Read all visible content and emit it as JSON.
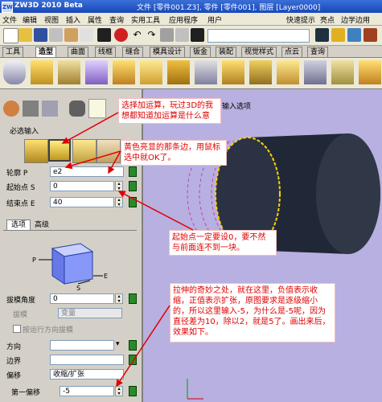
{
  "titlebar": {
    "app_title": "ZW3D 2010 Beta",
    "doc_info": "文件 [零件001.Z3], 零件 [零件001], 图层 [Layer0000]",
    "logo": "ZW"
  },
  "menubar": {
    "items": [
      "文件",
      "编辑",
      "视图",
      "插入",
      "属性",
      "查询",
      "实用工具",
      "应用程序",
      "用户"
    ],
    "right_items": [
      "快速提示",
      "亮点",
      "边学边用"
    ]
  },
  "tabs": [
    "工具",
    "造型",
    "曲面",
    "线框",
    "缝合",
    "模具设计",
    "钣金",
    "装配",
    "视觉样式",
    "点云",
    "查询"
  ],
  "active_tab": "造型",
  "panel": {
    "required_title": "必选输入",
    "profile_label": "轮廓 P",
    "profile_value": "e2",
    "start_label": "起始点 S",
    "start_value": "0",
    "end_label": "结束点 E",
    "end_value": "40",
    "subtabs": [
      "选项",
      "高级"
    ],
    "diagram_labels": {
      "p": "P",
      "s": "S",
      "e": "E"
    },
    "draft_angle_label": "拔模角度",
    "draft_angle_value": "0",
    "draft_type_label": "拔模",
    "draft_type_value": "变量",
    "draft_check_label": "按运行方向拔模",
    "direction_label": "方向",
    "boundary_label": "边界",
    "offset_label": "偏移",
    "offset_value": "收缩/扩张",
    "first_offset_label": "第一偏移",
    "first_offset_value": "-5"
  },
  "viewport": {
    "input_option": "输入选项"
  },
  "notes": {
    "n1": "选择加运算，玩过3D的我想都知道加运算是什么意",
    "n2": "黄色亮显的那条边，用鼠标选中就OK了。",
    "n3": "起始点一定要设0，要不然与前面连不到一块。",
    "n4": "拉伸的奇妙之处，就在这里，负值表示收缩，正值表示扩张，原图要求是逐级缩小的，所以这里输入-5，为什么是-5呢，因为直径差为10，除以2，就是5了。画出来后，效果如下。"
  },
  "colors": {
    "accent": "#1848b8",
    "note_text": "#e00000",
    "viewport_bg": "#b8b0e0",
    "highlight": "#ffd200",
    "go_button": "#2a8a2a"
  }
}
